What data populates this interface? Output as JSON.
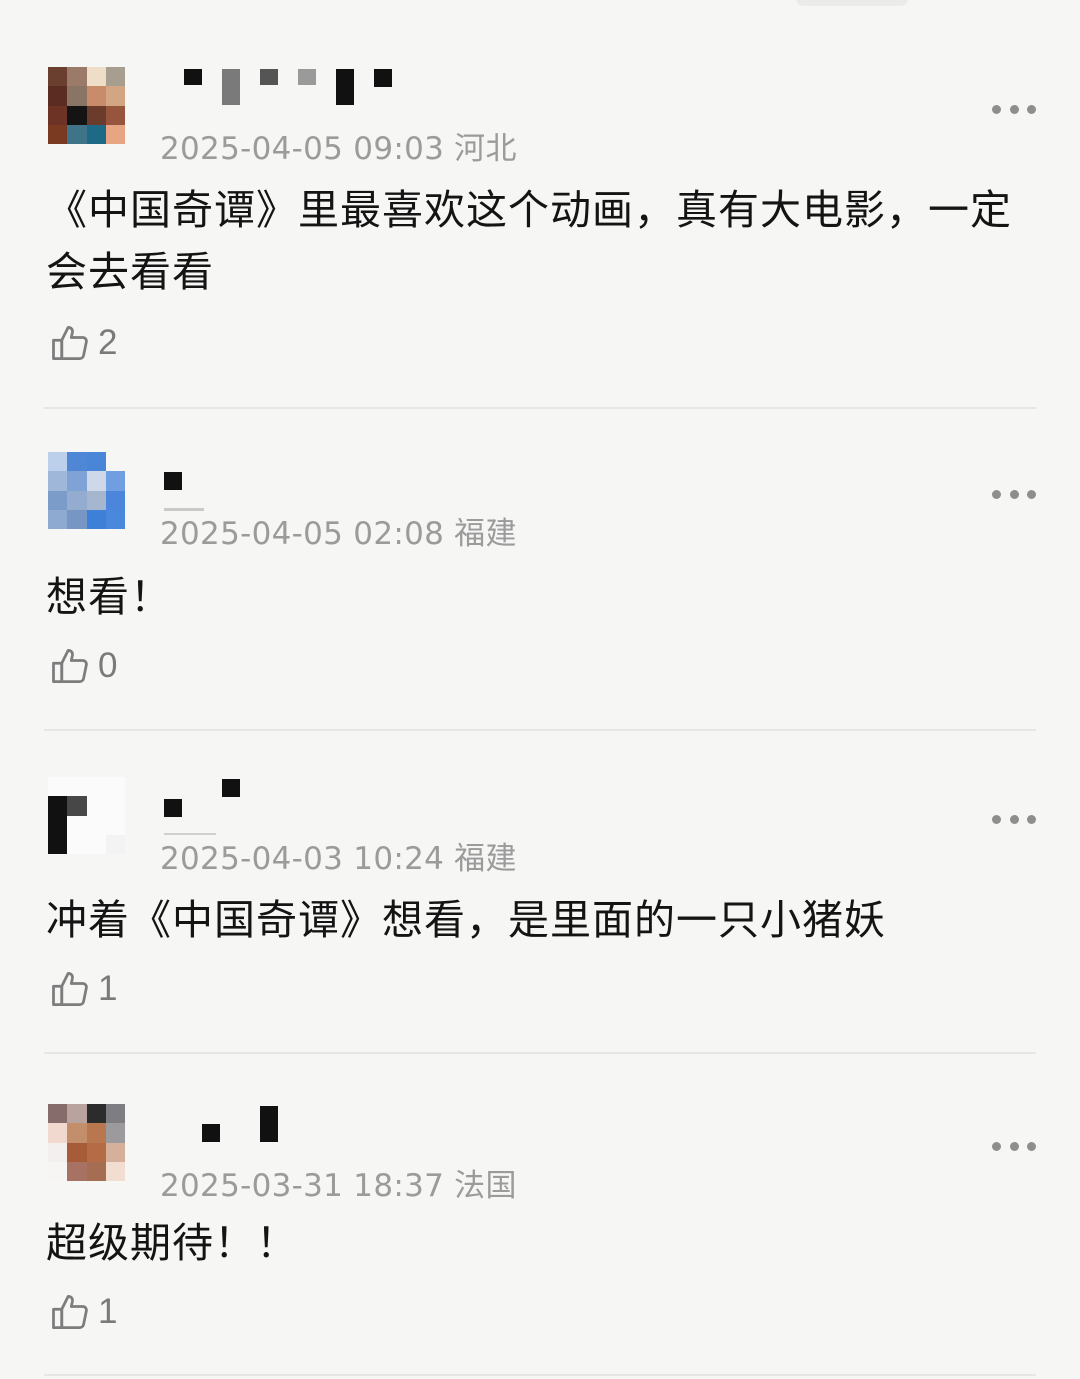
{
  "comments": [
    {
      "time": "2025-04-05 09:03",
      "location": "河北",
      "text": "《中国奇谭》里最喜欢这个动画，真有大电影，一定会去看看",
      "likes": "2"
    },
    {
      "time": "2025-04-05 02:08",
      "location": "福建",
      "text": "想看！",
      "likes": "0"
    },
    {
      "time": "2025-04-03 10:24",
      "location": "福建",
      "text": "冲着《中国奇谭》想看，是里面的一只小猪妖",
      "likes": "1"
    },
    {
      "time": "2025-03-31 18:37",
      "location": "法国",
      "text": "超级期待！！",
      "likes": "1"
    }
  ],
  "icons": {
    "like": "thumbs-up-icon",
    "more": "more-dots-icon",
    "avatar": "avatar-pixelated"
  },
  "colors": {
    "background": "#f6f6f4",
    "meta_text": "#9b9b9b",
    "divider": "#e6e6e4"
  }
}
